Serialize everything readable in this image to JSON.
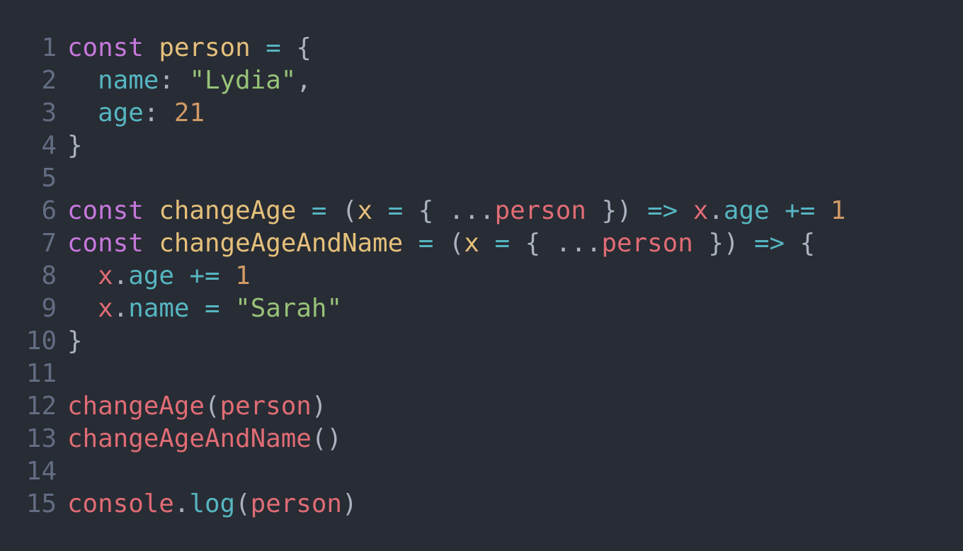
{
  "colors": {
    "background": "#282c34",
    "line_number": "#636d83",
    "keyword": "#c678dd",
    "declaration": "#e5c07b",
    "operator": "#56b6c2",
    "punctuation": "#abb2bf",
    "property": "#56b6c2",
    "string": "#98c379",
    "number": "#d19a66",
    "variable": "#e06c75"
  },
  "editor": {
    "lines": [
      {
        "number": "1",
        "tokens": [
          {
            "t": "const",
            "c": "#c678dd"
          },
          {
            "t": " "
          },
          {
            "t": "person",
            "c": "#e5c07b"
          },
          {
            "t": " "
          },
          {
            "t": "=",
            "c": "#56b6c2"
          },
          {
            "t": " "
          },
          {
            "t": "{",
            "c": "#abb2bf"
          }
        ]
      },
      {
        "number": "2",
        "tokens": [
          {
            "t": "  "
          },
          {
            "t": "name",
            "c": "#56b6c2"
          },
          {
            "t": ":",
            "c": "#abb2bf"
          },
          {
            "t": " "
          },
          {
            "t": "\"Lydia\"",
            "c": "#98c379"
          },
          {
            "t": ",",
            "c": "#abb2bf"
          }
        ]
      },
      {
        "number": "3",
        "tokens": [
          {
            "t": "  "
          },
          {
            "t": "age",
            "c": "#56b6c2"
          },
          {
            "t": ":",
            "c": "#abb2bf"
          },
          {
            "t": " "
          },
          {
            "t": "21",
            "c": "#d19a66"
          }
        ]
      },
      {
        "number": "4",
        "tokens": [
          {
            "t": "}",
            "c": "#abb2bf"
          }
        ]
      },
      {
        "number": "5",
        "tokens": []
      },
      {
        "number": "6",
        "tokens": [
          {
            "t": "const",
            "c": "#c678dd"
          },
          {
            "t": " "
          },
          {
            "t": "changeAge",
            "c": "#e5c07b"
          },
          {
            "t": " "
          },
          {
            "t": "=",
            "c": "#56b6c2"
          },
          {
            "t": " "
          },
          {
            "t": "(",
            "c": "#abb2bf"
          },
          {
            "t": "x",
            "c": "#e5c07b"
          },
          {
            "t": " "
          },
          {
            "t": "=",
            "c": "#56b6c2"
          },
          {
            "t": " "
          },
          {
            "t": "{",
            "c": "#abb2bf"
          },
          {
            "t": " "
          },
          {
            "t": "...",
            "c": "#abb2bf"
          },
          {
            "t": "person",
            "c": "#e06c75"
          },
          {
            "t": " "
          },
          {
            "t": "})",
            "c": "#abb2bf"
          },
          {
            "t": " "
          },
          {
            "t": "=>",
            "c": "#56b6c2"
          },
          {
            "t": " "
          },
          {
            "t": "x",
            "c": "#e06c75"
          },
          {
            "t": ".",
            "c": "#abb2bf"
          },
          {
            "t": "age",
            "c": "#56b6c2"
          },
          {
            "t": " "
          },
          {
            "t": "+=",
            "c": "#56b6c2"
          },
          {
            "t": " "
          },
          {
            "t": "1",
            "c": "#d19a66"
          }
        ]
      },
      {
        "number": "7",
        "tokens": [
          {
            "t": "const",
            "c": "#c678dd"
          },
          {
            "t": " "
          },
          {
            "t": "changeAgeAndName",
            "c": "#e5c07b"
          },
          {
            "t": " "
          },
          {
            "t": "=",
            "c": "#56b6c2"
          },
          {
            "t": " "
          },
          {
            "t": "(",
            "c": "#abb2bf"
          },
          {
            "t": "x",
            "c": "#e5c07b"
          },
          {
            "t": " "
          },
          {
            "t": "=",
            "c": "#56b6c2"
          },
          {
            "t": " "
          },
          {
            "t": "{",
            "c": "#abb2bf"
          },
          {
            "t": " "
          },
          {
            "t": "...",
            "c": "#abb2bf"
          },
          {
            "t": "person",
            "c": "#e06c75"
          },
          {
            "t": " "
          },
          {
            "t": "})",
            "c": "#abb2bf"
          },
          {
            "t": " "
          },
          {
            "t": "=>",
            "c": "#56b6c2"
          },
          {
            "t": " "
          },
          {
            "t": "{",
            "c": "#abb2bf"
          }
        ]
      },
      {
        "number": "8",
        "tokens": [
          {
            "t": "  "
          },
          {
            "t": "x",
            "c": "#e06c75"
          },
          {
            "t": ".",
            "c": "#abb2bf"
          },
          {
            "t": "age",
            "c": "#56b6c2"
          },
          {
            "t": " "
          },
          {
            "t": "+=",
            "c": "#56b6c2"
          },
          {
            "t": " "
          },
          {
            "t": "1",
            "c": "#d19a66"
          }
        ]
      },
      {
        "number": "9",
        "tokens": [
          {
            "t": "  "
          },
          {
            "t": "x",
            "c": "#e06c75"
          },
          {
            "t": ".",
            "c": "#abb2bf"
          },
          {
            "t": "name",
            "c": "#56b6c2"
          },
          {
            "t": " "
          },
          {
            "t": "=",
            "c": "#56b6c2"
          },
          {
            "t": " "
          },
          {
            "t": "\"Sarah\"",
            "c": "#98c379"
          }
        ]
      },
      {
        "number": "10",
        "tokens": [
          {
            "t": "}",
            "c": "#abb2bf"
          }
        ]
      },
      {
        "number": "11",
        "tokens": []
      },
      {
        "number": "12",
        "tokens": [
          {
            "t": "changeAge",
            "c": "#e06c75"
          },
          {
            "t": "(",
            "c": "#abb2bf"
          },
          {
            "t": "person",
            "c": "#e06c75"
          },
          {
            "t": ")",
            "c": "#abb2bf"
          }
        ]
      },
      {
        "number": "13",
        "tokens": [
          {
            "t": "changeAgeAndName",
            "c": "#e06c75"
          },
          {
            "t": "()",
            "c": "#abb2bf"
          }
        ]
      },
      {
        "number": "14",
        "tokens": []
      },
      {
        "number": "15",
        "tokens": [
          {
            "t": "console",
            "c": "#e06c75"
          },
          {
            "t": ".",
            "c": "#abb2bf"
          },
          {
            "t": "log",
            "c": "#56b6c2"
          },
          {
            "t": "(",
            "c": "#abb2bf"
          },
          {
            "t": "person",
            "c": "#e06c75"
          },
          {
            "t": ")",
            "c": "#abb2bf"
          }
        ]
      }
    ]
  }
}
